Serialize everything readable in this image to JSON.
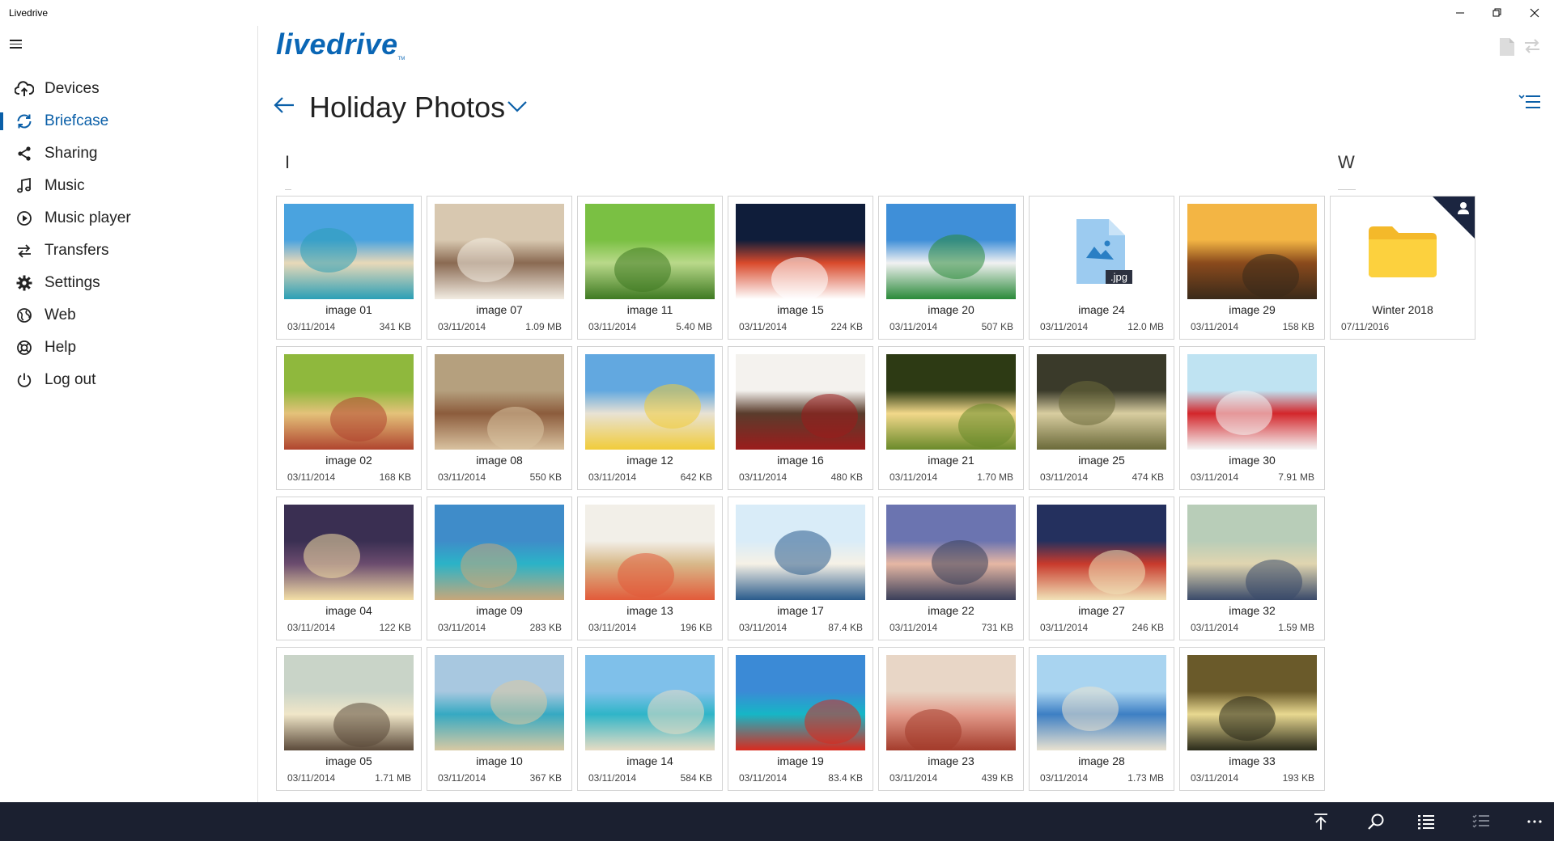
{
  "window": {
    "title": "Livedrive",
    "minimize": "–",
    "restore": "❐",
    "close": "✕"
  },
  "brand": {
    "logo_text": "livedrive",
    "logo_tm": "TM"
  },
  "nav": [
    {
      "label": "Devices",
      "icon": "cloud-upload-icon"
    },
    {
      "label": "Briefcase",
      "icon": "sync-icon",
      "active": true
    },
    {
      "label": "Sharing",
      "icon": "share-icon"
    },
    {
      "label": "Music",
      "icon": "music-note-icon"
    },
    {
      "label": "Music player",
      "icon": "play-circle-icon"
    },
    {
      "label": "Transfers",
      "icon": "transfer-arrows-icon"
    },
    {
      "label": "Settings",
      "icon": "gear-icon"
    },
    {
      "label": "Web",
      "icon": "globe-icon"
    },
    {
      "label": "Help",
      "icon": "lifebuoy-icon"
    },
    {
      "label": "Log out",
      "icon": "power-icon"
    }
  ],
  "header": {
    "folder_title": "Holiday Photos"
  },
  "groups": {
    "first": "I",
    "second": "W"
  },
  "accent": "#0a5fa8",
  "appbar_color": "#1b2030",
  "items": [
    {
      "name": "image 01",
      "date": "03/11/2014",
      "size": "341 KB",
      "kind": "photo",
      "palette": [
        "#4aa3df",
        "#e8d9b8",
        "#2b9fb6"
      ]
    },
    {
      "name": "image 02",
      "date": "03/11/2014",
      "size": "168 KB",
      "kind": "photo",
      "palette": [
        "#8fb83d",
        "#e4c27a",
        "#b0452f"
      ]
    },
    {
      "name": "image 04",
      "date": "03/11/2014",
      "size": "122 KB",
      "kind": "photo",
      "palette": [
        "#3a2f52",
        "#6b4c6e",
        "#f4dfa6"
      ]
    },
    {
      "name": "image 05",
      "date": "03/11/2014",
      "size": "1.71 MB",
      "kind": "photo",
      "palette": [
        "#c9d4c8",
        "#f0e6c8",
        "#5b4a3a"
      ]
    },
    {
      "name": "image 07",
      "date": "03/11/2014",
      "size": "1.09 MB",
      "kind": "photo",
      "palette": [
        "#d8c8b0",
        "#8a6a52",
        "#f2ece2"
      ]
    },
    {
      "name": "image 08",
      "date": "03/11/2014",
      "size": "550 KB",
      "kind": "photo",
      "palette": [
        "#b5a07e",
        "#8c5c3c",
        "#d9c2a0"
      ]
    },
    {
      "name": "image 09",
      "date": "03/11/2014",
      "size": "283 KB",
      "kind": "photo",
      "palette": [
        "#3f8cc9",
        "#2bb3c7",
        "#c7a77a"
      ]
    },
    {
      "name": "image 10",
      "date": "03/11/2014",
      "size": "367 KB",
      "kind": "photo",
      "palette": [
        "#a8c8e0",
        "#36a9c2",
        "#d8c9a3"
      ]
    },
    {
      "name": "image 11",
      "date": "03/11/2014",
      "size": "5.40 MB",
      "kind": "photo",
      "palette": [
        "#7ac043",
        "#b9d98a",
        "#3f7a22"
      ]
    },
    {
      "name": "image 12",
      "date": "03/11/2014",
      "size": "642 KB",
      "kind": "photo",
      "palette": [
        "#62a8e0",
        "#e8e2d4",
        "#f1cc3a"
      ]
    },
    {
      "name": "image 13",
      "date": "03/11/2014",
      "size": "196 KB",
      "kind": "photo",
      "palette": [
        "#f2efe8",
        "#d8b98a",
        "#e25b3a"
      ]
    },
    {
      "name": "image 14",
      "date": "03/11/2014",
      "size": "584 KB",
      "kind": "photo",
      "palette": [
        "#7fc0ea",
        "#2fb5c8",
        "#e7dcc4"
      ]
    },
    {
      "name": "image 15",
      "date": "03/11/2014",
      "size": "224 KB",
      "kind": "photo",
      "palette": [
        "#0f1d3a",
        "#d94a2c",
        "#ffffff"
      ]
    },
    {
      "name": "image 16",
      "date": "03/11/2014",
      "size": "480 KB",
      "kind": "photo",
      "palette": [
        "#f4f2ee",
        "#5a3c2c",
        "#9b1c1c"
      ]
    },
    {
      "name": "image 17",
      "date": "03/11/2014",
      "size": "87.4 KB",
      "kind": "photo",
      "palette": [
        "#d9ecf8",
        "#f6f1e6",
        "#2a5b8c"
      ]
    },
    {
      "name": "image 19",
      "date": "03/11/2014",
      "size": "83.4 KB",
      "kind": "photo",
      "palette": [
        "#3b8ad6",
        "#16b6c6",
        "#d92a1e"
      ]
    },
    {
      "name": "image 20",
      "date": "03/11/2014",
      "size": "507 KB",
      "kind": "photo",
      "palette": [
        "#3f8fd8",
        "#f1f1f1",
        "#2a8a3a"
      ]
    },
    {
      "name": "image 21",
      "date": "03/11/2014",
      "size": "1.70 MB",
      "kind": "photo",
      "palette": [
        "#2d3a14",
        "#f2d88a",
        "#6a8a2a"
      ]
    },
    {
      "name": "image 22",
      "date": "03/11/2014",
      "size": "731 KB",
      "kind": "photo",
      "palette": [
        "#6b74b0",
        "#e6b7a4",
        "#3a3f5a"
      ]
    },
    {
      "name": "image 23",
      "date": "03/11/2014",
      "size": "439 KB",
      "kind": "photo",
      "palette": [
        "#e8d6c6",
        "#e29a8a",
        "#a43c2c"
      ]
    },
    {
      "name": "image 24",
      "date": "03/11/2014",
      "size": "12.0 MB",
      "kind": "file",
      "ext": ".jpg"
    },
    {
      "name": "image 25",
      "date": "03/11/2014",
      "size": "474 KB",
      "kind": "photo",
      "palette": [
        "#3a3a2a",
        "#d8cda0",
        "#6b6a3a"
      ]
    },
    {
      "name": "image 27",
      "date": "03/11/2014",
      "size": "246 KB",
      "kind": "photo",
      "palette": [
        "#24305e",
        "#c83a2c",
        "#f1e2b8"
      ]
    },
    {
      "name": "image 28",
      "date": "03/11/2014",
      "size": "1.73 MB",
      "kind": "photo",
      "palette": [
        "#a9d4f0",
        "#3d7fc4",
        "#e9e2d0"
      ]
    },
    {
      "name": "image 29",
      "date": "03/11/2014",
      "size": "158 KB",
      "kind": "photo",
      "palette": [
        "#f3b544",
        "#8a4a1c",
        "#3a2a1a"
      ]
    },
    {
      "name": "image 30",
      "date": "03/11/2014",
      "size": "7.91 MB",
      "kind": "photo",
      "palette": [
        "#bfe3f2",
        "#d3262b",
        "#f4f4f4"
      ]
    },
    {
      "name": "image 32",
      "date": "03/11/2014",
      "size": "1.59 MB",
      "kind": "photo",
      "palette": [
        "#b8cdb8",
        "#e0d5b0",
        "#3a4a6a"
      ]
    },
    {
      "name": "image 33",
      "date": "03/11/2014",
      "size": "193 KB",
      "kind": "photo",
      "palette": [
        "#6a5a2a",
        "#e8d890",
        "#2a2a1a"
      ]
    },
    {
      "name": "Winter 2018",
      "date": "07/11/2016",
      "size": "",
      "kind": "folder",
      "shared": true
    }
  ],
  "appbar": {
    "buttons": [
      "scroll-to-top-icon",
      "search-icon",
      "list-view-icon",
      "select-list-icon",
      "more-icon"
    ]
  }
}
